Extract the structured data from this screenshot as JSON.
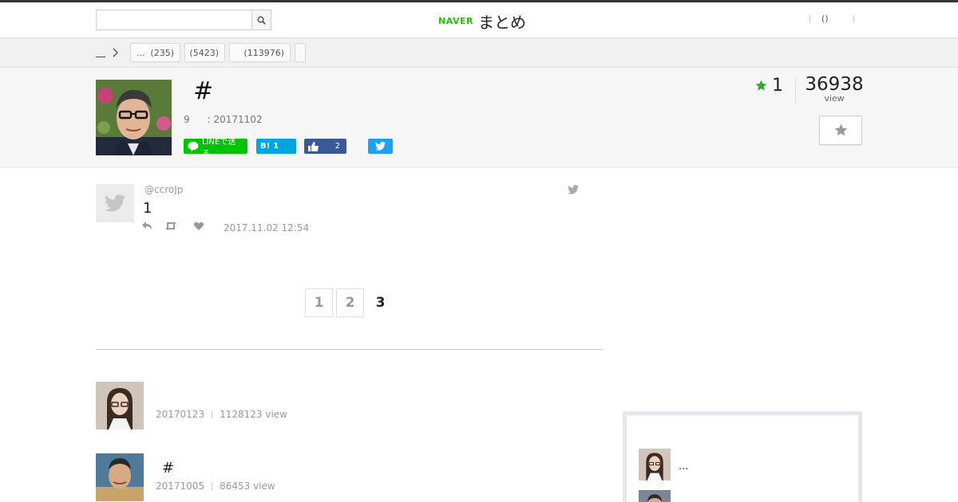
{
  "header": {
    "search_placeholder": "",
    "logo_naver": "NAVER",
    "logo_matome": "まとめ",
    "right_link": "()"
  },
  "breadcrumb": {
    "home": "__",
    "tags": [
      {
        "label": "...",
        "count": "(235)"
      },
      {
        "label": "",
        "count": "(5423)"
      },
      {
        "label": "",
        "count": "(113976)"
      },
      {
        "label": "",
        "count": ""
      }
    ]
  },
  "article": {
    "title": "#",
    "meta_count": "9",
    "meta_date": ": 20171102",
    "share": {
      "line_label": "LINEで送る",
      "hatena_label": "B!",
      "hatena_count": "1",
      "fb_count": "2"
    },
    "favorites": "1",
    "views": "36938",
    "views_label": "view"
  },
  "tweet": {
    "handle": "@ccroJp",
    "text": "1",
    "date": "2017.11.02 12:54"
  },
  "pagination": {
    "pages": [
      "1",
      "2",
      "3"
    ],
    "current": "3"
  },
  "related": [
    {
      "title": "",
      "date": "20170123",
      "views": "1128123 view"
    },
    {
      "title": "#",
      "date": "20171005",
      "views": "86453 view"
    }
  ],
  "sidebar": {
    "items": [
      {
        "text": "..."
      },
      {
        "text": ""
      }
    ]
  },
  "colors": {
    "accent_green": "#1ec800",
    "line_green": "#00c300",
    "hatena_blue": "#00a4de",
    "facebook_blue": "#3b5998",
    "twitter_blue": "#1da1f2",
    "star_green": "#3aa33a"
  }
}
